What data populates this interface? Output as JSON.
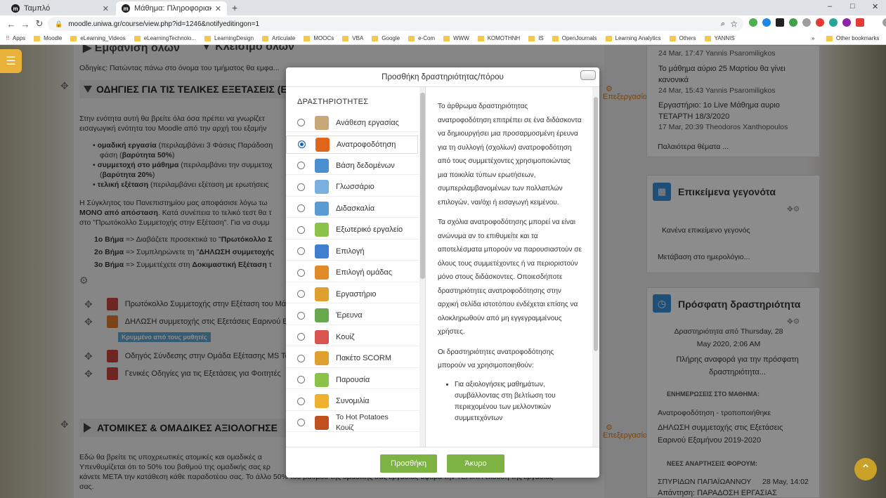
{
  "browser": {
    "tabs": [
      {
        "title": "Ταμπλό",
        "favicon": "m"
      },
      {
        "title": "Μάθημα: Πληροφοριακά Συστή",
        "favicon": "m"
      }
    ],
    "new_tab": "+",
    "window_controls": {
      "minimize": "–",
      "maximize": "□",
      "close": "✕"
    },
    "url": "moodle.uniwa.gr/course/view.php?id=1246&notifyeditingon=1",
    "bookmarks": [
      "Apps",
      "Moodle",
      "eLearning_Videos",
      "eLearningTechnolo...",
      "LearningDesign",
      "Articulate",
      "MOOCs",
      "VBA",
      "Google",
      "e-Com",
      "WWW",
      "ΚΟΜΟΤΗΝΗ",
      "IS",
      "OpenJournals",
      "Learning Analytics",
      "Others",
      "YANNIS"
    ],
    "other_bookmarks": "Other bookmarks",
    "more_bookmarks": "»"
  },
  "course": {
    "top_tabs": [
      "Εμφάνιση όλων",
      "Κλείσιμο όλων"
    ],
    "top_hint": "Οδηγίες: Πατώντας πάνω στο όνομα του τμήματος θα εμφα...",
    "section1_title": "ΟΔΗΓΙΕΣ ΓΙΑ ΤΙΣ ΤΕΛΙΚΕΣ ΕΞΕΤΑΣΕΙΣ (Ε",
    "section1_lines": [
      "Στην ενότητα αυτή θα βρείτε όλα όσα πρέπει να γνωρίζετ",
      "εισαγωγική ενότητα του Moodle από την αρχή του εξαμήν"
    ],
    "bullets": [
      {
        "bold": "ομαδική εργασία",
        "text": " (περιλαμβάνει 3 Φάσεις Παράδοση",
        "sub": "φάση (",
        "sub_bold": "βαρύτητα 50%",
        "sub_end": ")"
      },
      {
        "bold": "συμμετοχή στο μάθημα",
        "text": " (περιλαμβάνει την συμμετοχ",
        "sub": "(",
        "sub_bold": "βαρύτητα 20%",
        "sub_end": ")"
      },
      {
        "bold": "τελική εξέταση",
        "text": " (περιλαμβάνει εξέταση με ερωτήσεις"
      }
    ],
    "para2": [
      "Η Σύγκλητος του Πανεπιστημίου μας αποφάσισε λόγω τω",
      "ΜΟΝΟ από απόσταση",
      ". Κατά συνέπεια το τελικό τεστ θα τ",
      "στο \"Πρωτόκολλο Συμμετοχής στην Εξέταση\". Για να συμμ"
    ],
    "steps": [
      {
        "step": "1ο Βήμα",
        "text": " => Διαβάζετε προσεκτικά το \"",
        "bold": "Πρωτόκολλο Σ"
      },
      {
        "step": "2ο Βήμα",
        "text": " => Συμπληρώνετε τη \"",
        "bold": "ΔΗΛΩΣΗ συμμετοχής"
      },
      {
        "step": "3ο Βήμα",
        "text": " => Συμμετέχετε στη ",
        "bold": "Δοκιμαστική Εξέταση",
        "end": " τ"
      }
    ],
    "activities": [
      "Πρωτόκολλο Συμμετοχής στην Εξέταση του Μάθ",
      "ΔΗΛΩΣΗ συμμετοχής στις Εξετάσεις Εαρινού Εξ",
      "Οδηγός Σύνδεσης στην Ομάδα Εξέτασης MS Tea",
      "Γενικές Οδηγίες για τις Εξετάσεις για Φοιτητές"
    ],
    "hidden_badge": "Κρυμμένο από τους μαθητές",
    "section2_title": "ΑΤΟΜΙΚΕΣ & ΟΜΑΔΙΚΕΣ ΑΞΙΟΛΟΓΗΣΕ",
    "section2_lines": [
      "Εδώ θα βρείτε τις υποχρεωτικές ατομικές και ομαδικές α",
      "Υπενθυμίζεται ότι το 50% του βαθμού της ομαδικής σας ερ",
      "κάνετε ΜΕΤΑ την κατάθεση κάθε παραδοτέου σας. Το άλλο 50% του βαθμού της ομαδικής σας εργασίας αφορά την ΤΕΛΙΚΗ έκδοση της εργασίας",
      "σας."
    ],
    "edit_label": "Επεξεργασία"
  },
  "sidebar": {
    "forum": [
      {
        "meta": "24 Mar, 17:47  Yannis Psaromiligkos",
        "link": [
          "Το μάθημα αύριο 25 Μαρτίου θα γίνει",
          "κανονικά"
        ]
      },
      {
        "meta": "24 Mar, 15:43  Yannis Psaromiligkos",
        "link": [
          "Εργαστήριο: 1ο Live Μάθημα αυριο",
          "ΤΕΤΑΡΤΗ 18/3/2020"
        ]
      },
      {
        "meta": "17 Mar, 20:39  Theodoros Xanthopoulos"
      }
    ],
    "older_topics": "Παλαιότερα θέματα ...",
    "upcoming_title": "Επικείμενα γεγονότα",
    "upcoming_none": "Κανένα επικείμενο γεγονός",
    "goto_calendar": "Μετάβαση στο ημερολόγιο...",
    "recent_title": "Πρόσφατη δραστηριότητα",
    "recent_since": [
      "Δραστηριότητα από Thursday, 28",
      "May 2020, 2:06 AM"
    ],
    "recent_full": [
      "Πλήρης αναφορά για την πρόσφατη",
      "δραστηριότητα..."
    ],
    "updates_heading": "ΕΝΗΜΕΡΩΣΕΙΣ ΣΤΟ ΜΑΘΗΜΑ:",
    "update_item": "Ανατροφοδότηση - τροποποιήθηκε",
    "update_link": [
      "ΔΗΛΩΣΗ συμμετοχής στις Εξετάσεις",
      "Εαρινού Εξαμήνου 2019-2020"
    ],
    "forum_heading": "ΝΕΕΣ ΑΝΑΡΤΗΣΕΙΣ ΦΟΡΟΥΜ:",
    "post_author": "ΣΠΥΡΙΔΩΝ ΠΑΠΑΪΩΑΝΝΟΥ",
    "post_date": "28 May, 14:02",
    "post_link": "Απάντηση: ΠΑΡΑΔΟΣΗ ΕΡΓΑΣΙΑΣ"
  },
  "modal": {
    "title": "Προσθήκη δραστηριότητας/πόρου",
    "list_heading": "ΔΡΑΣΤΗΡΙΟΤΗΤΕΣ",
    "options": [
      {
        "label": "Ανάθεση εργασίας",
        "icon": "assignment-icon",
        "color": "#c8a878"
      },
      {
        "label": "Ανατροφοδότηση",
        "icon": "feedback-megaphone-icon",
        "color": "#e0651a",
        "selected": true
      },
      {
        "label": "Βάση δεδομένων",
        "icon": "database-icon",
        "color": "#4a8fd0"
      },
      {
        "label": "Γλωσσάριο",
        "icon": "glossary-icon",
        "color": "#7ab0e0"
      },
      {
        "label": "Διδασκαλία",
        "icon": "lesson-icon",
        "color": "#5b9bd5"
      },
      {
        "label": "Εξωτερικό εργαλείο",
        "icon": "puzzle-icon",
        "color": "#8bc34a"
      },
      {
        "label": "Επιλογή",
        "icon": "question-icon",
        "color": "#3f7fd0"
      },
      {
        "label": "Επιλογή ομάδας",
        "icon": "group-choice-icon",
        "color": "#e08a2a"
      },
      {
        "label": "Εργαστήριο",
        "icon": "workshop-icon",
        "color": "#e0a030"
      },
      {
        "label": "Έρευνα",
        "icon": "survey-chart-icon",
        "color": "#6aa84f"
      },
      {
        "label": "Κουίζ",
        "icon": "quiz-check-icon",
        "color": "#d9534f"
      },
      {
        "label": "Πακέτο SCORM",
        "icon": "scorm-package-icon",
        "color": "#e0a030"
      },
      {
        "label": "Παρουσία",
        "icon": "attendance-icon",
        "color": "#8bc34a"
      },
      {
        "label": "Συνομιλία",
        "icon": "chat-icon",
        "color": "#f0b030"
      },
      {
        "label": "Το Hot Potatoes Κουίζ",
        "icon": "hotpotatoes-icon",
        "color": "#c05020"
      }
    ],
    "description": [
      "Το άρθρωμα δραστηριότητας ανατροφοδότηση επιτρέπει σε ένα διδάσκοντα να δημιουργήσει μια προσαρμοσμένη έρευνα για τη συλλογή (σχολίων) ανατροφοδότηση από τους συμμετέχοντες χρησιμοποιώντας μια ποικιλία τύπων ερωτήσεων, συμπεριλαμβανομένων των πολλαπλών επιλογών, ναι/όχι ή εισαγωγή κειμένου.",
      "Τα σχόλια ανατροφοδότησης μπορεί να είναι ανώνυμα αν το επιθυμείτε και τα αποτελέσματα μπορούν να παρουσιαστούν σε όλους τους συμμετέχοντες ή να περιοριστούν μόνο στους διδάσκοντες. Οποιεσδήποτε δραστηριότητες ανατροφοδότησης στην αρχική σελίδα ιστοτόπου ενδέχεται επίσης να ολοκληρωθούν από μη εγγεγραμμένους χρήστες.",
      "Οι δραστηριότητες ανατροφοδότησης μπορούν να χρησιμοποιηθούν:"
    ],
    "uses": [
      "Για αξιολογήσεις μαθημάτων, συμβάλλοντας στη βελτίωση του περιεχομένου των μελλοντικών συμμετεχόντων"
    ],
    "add_button": "Προσθήκη",
    "cancel_button": "Άκυρο"
  }
}
